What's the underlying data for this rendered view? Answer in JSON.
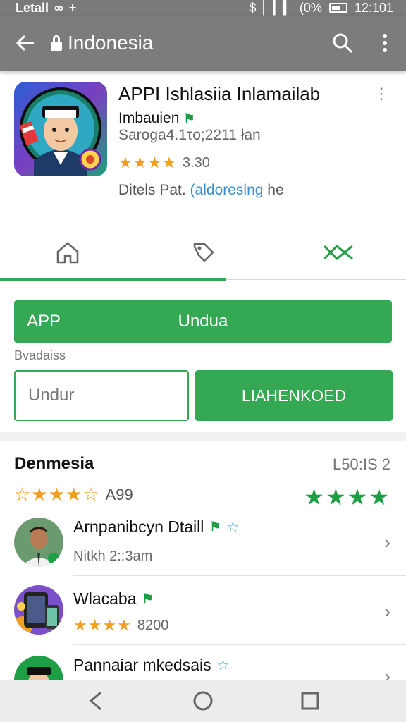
{
  "status_bar": {
    "carrier": "Letall",
    "battery_percent": "(0%",
    "time": "12:101"
  },
  "app_bar": {
    "title": "Indonesia"
  },
  "app": {
    "name": "APPI Ishlasiia Inlamailab",
    "developer": "Imbauien",
    "subtitle": "Saroga4.1τo;2211 łan",
    "rating_value": "3.30",
    "details_prefix": "Ditels Pat.",
    "details_link": "(aldoreslng",
    "details_suffix": "he"
  },
  "buttons": {
    "primary_prefix": "APP",
    "primary_label": "Undua",
    "section_label": "Bvadaiss",
    "secondary_label": "Undur",
    "green_label": "LIAHENKOED"
  },
  "list": {
    "title": "Denmesia",
    "meta": "L50:IS 2",
    "rating_value": "A99",
    "items": [
      {
        "title": "Arnpanibcyn Dtaill",
        "subtitle": "Nitkh 2::3am",
        "has_stars": false
      },
      {
        "title": "Wlacaba",
        "subtitle": "8200",
        "has_stars": true
      },
      {
        "title": "Pannaiar mkedsais",
        "subtitle": "",
        "has_stars": false
      }
    ]
  },
  "colors": {
    "accent": "#34a853",
    "star": "#f0a020",
    "link": "#3a8fd0",
    "app_bar": "#7c7c7c"
  },
  "icons": {
    "back": "arrow-left-icon",
    "lock": "lock-icon",
    "search": "search-icon",
    "more": "more-vert-icon",
    "tab1": "home-icon",
    "tab2": "tag-icon",
    "tab3": "ribbon-icon",
    "nav_back": "triangle-back-icon",
    "nav_home": "circle-home-icon",
    "nav_recent": "square-recents-icon"
  }
}
